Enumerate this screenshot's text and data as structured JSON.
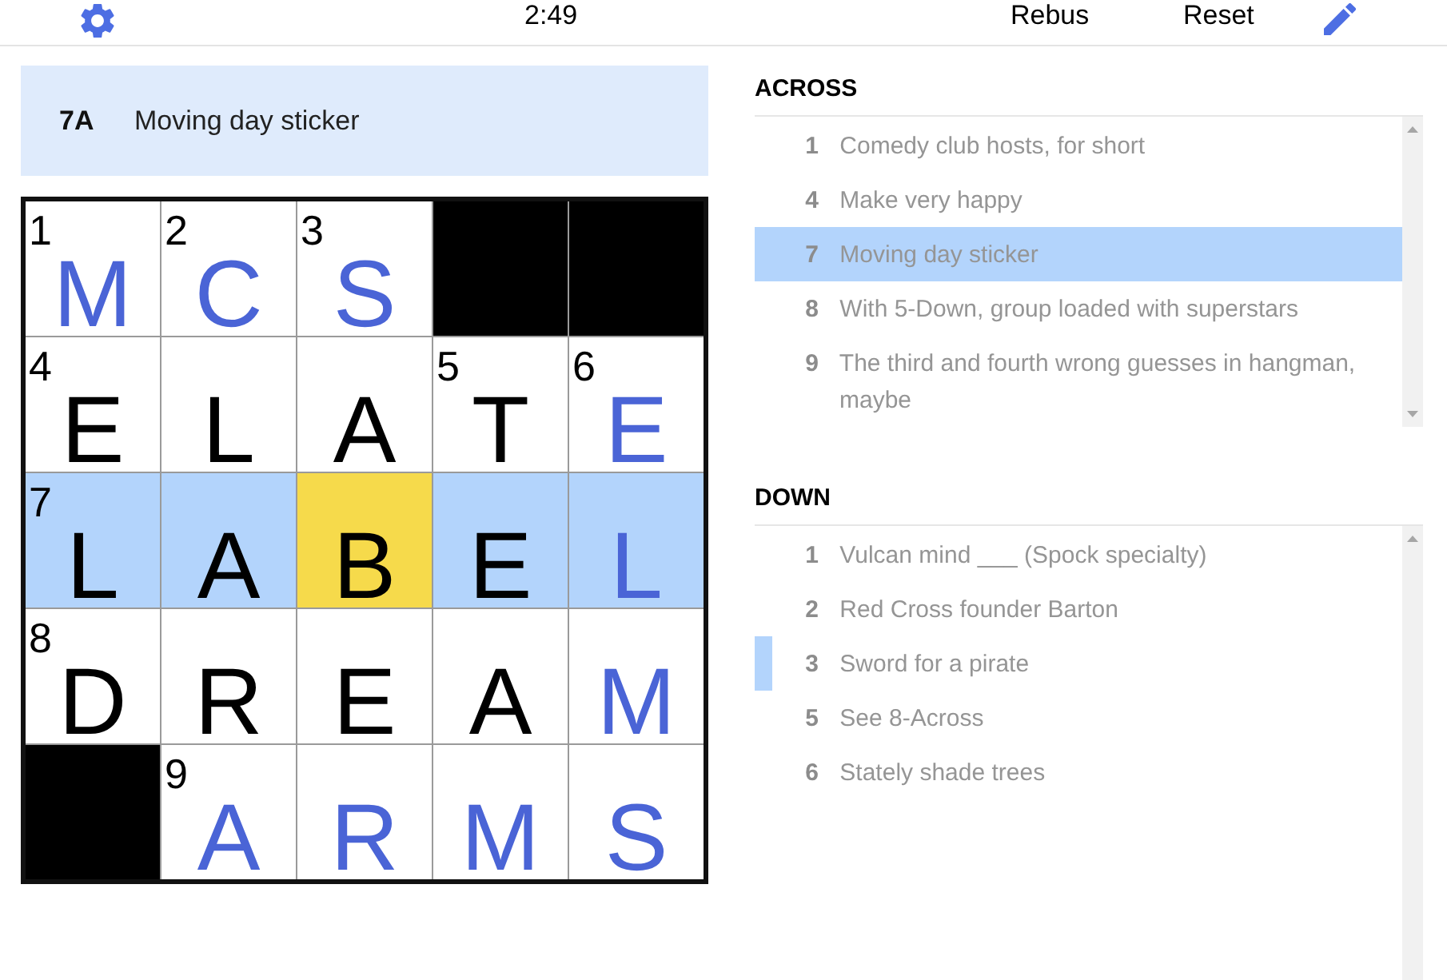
{
  "toolbar": {
    "time": "2:49",
    "buttons": [
      "Rebus",
      "Reset"
    ]
  },
  "active_clue": {
    "label": "7A",
    "text": "Moving day sticker"
  },
  "grid": {
    "rows": [
      {
        "cells": [
          {
            "kind": "letter",
            "number": "1",
            "letter": "M",
            "color": "#4a64d6",
            "highlighted": false,
            "selected": false
          },
          {
            "kind": "letter",
            "number": "2",
            "letter": "C",
            "color": "#4a64d6",
            "highlighted": false,
            "selected": false
          },
          {
            "kind": "letter",
            "number": "3",
            "letter": "S",
            "color": "#4a64d6",
            "highlighted": false,
            "selected": false
          },
          {
            "kind": "block"
          },
          {
            "kind": "block"
          }
        ]
      },
      {
        "cells": [
          {
            "kind": "letter",
            "number": "4",
            "letter": "E",
            "color": "#000000",
            "highlighted": false,
            "selected": false
          },
          {
            "kind": "letter",
            "letter": "L",
            "color": "#000000",
            "highlighted": false,
            "selected": false
          },
          {
            "kind": "letter",
            "letter": "A",
            "color": "#000000",
            "highlighted": false,
            "selected": false
          },
          {
            "kind": "letter",
            "number": "5",
            "letter": "T",
            "color": "#000000",
            "highlighted": false,
            "selected": false
          },
          {
            "kind": "letter",
            "number": "6",
            "letter": "E",
            "color": "#4a64d6",
            "highlighted": false,
            "selected": false
          }
        ]
      },
      {
        "cells": [
          {
            "kind": "letter",
            "number": "7",
            "letter": "L",
            "color": "#000000",
            "highlighted": true,
            "selected": false
          },
          {
            "kind": "letter",
            "letter": "A",
            "color": "#000000",
            "highlighted": true,
            "selected": false
          },
          {
            "kind": "letter",
            "letter": "B",
            "color": "#000000",
            "highlighted": true,
            "selected": true
          },
          {
            "kind": "letter",
            "letter": "E",
            "color": "#000000",
            "highlighted": true,
            "selected": false
          },
          {
            "kind": "letter",
            "letter": "L",
            "color": "#4a64d6",
            "highlighted": true,
            "selected": false
          }
        ]
      },
      {
        "cells": [
          {
            "kind": "letter",
            "number": "8",
            "letter": "D",
            "color": "#000000",
            "highlighted": false,
            "selected": false
          },
          {
            "kind": "letter",
            "letter": "R",
            "color": "#000000",
            "highlighted": false,
            "selected": false
          },
          {
            "kind": "letter",
            "letter": "E",
            "color": "#000000",
            "highlighted": false,
            "selected": false
          },
          {
            "kind": "letter",
            "letter": "A",
            "color": "#000000",
            "highlighted": false,
            "selected": false
          },
          {
            "kind": "letter",
            "letter": "M",
            "color": "#4a64d6",
            "highlighted": false,
            "selected": false
          }
        ]
      },
      {
        "cells": [
          {
            "kind": "block"
          },
          {
            "kind": "letter",
            "number": "9",
            "letter": "A",
            "color": "#4a64d6",
            "highlighted": false,
            "selected": false
          },
          {
            "kind": "letter",
            "letter": "R",
            "color": "#4a64d6",
            "highlighted": false,
            "selected": false
          },
          {
            "kind": "letter",
            "letter": "M",
            "color": "#4a64d6",
            "highlighted": false,
            "selected": false
          },
          {
            "kind": "letter",
            "letter": "S",
            "color": "#4a64d6",
            "highlighted": false,
            "selected": false
          }
        ]
      }
    ]
  },
  "clue_lists": [
    {
      "heading": "ACROSS",
      "clues": [
        {
          "number": "1",
          "text": "Comedy club hosts, for short",
          "selected": false,
          "crossing": false
        },
        {
          "number": "4",
          "text": "Make very happy",
          "selected": false,
          "crossing": false
        },
        {
          "number": "7",
          "text": "Moving day sticker",
          "selected": true,
          "crossing": false
        },
        {
          "number": "8",
          "text": "With 5-Down, group loaded with superstars",
          "selected": false,
          "crossing": false
        },
        {
          "number": "9",
          "text": "The third and fourth wrong guesses in hangman, maybe",
          "selected": false,
          "crossing": false
        }
      ]
    },
    {
      "heading": "DOWN",
      "clues": [
        {
          "number": "1",
          "text": "Vulcan mind ___ (Spock specialty)",
          "selected": false,
          "crossing": false
        },
        {
          "number": "2",
          "text": "Red Cross founder Barton",
          "selected": false,
          "crossing": false
        },
        {
          "number": "3",
          "text": "Sword for a pirate",
          "selected": false,
          "crossing": true
        },
        {
          "number": "5",
          "text": "See 8-Across",
          "selected": false,
          "crossing": false
        },
        {
          "number": "6",
          "text": "Stately shade trees",
          "selected": false,
          "crossing": false
        }
      ]
    }
  ]
}
